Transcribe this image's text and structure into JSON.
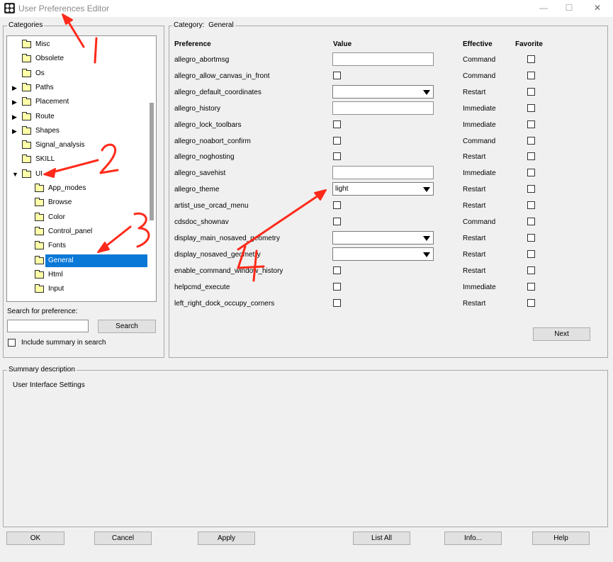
{
  "window": {
    "title": "User Preferences Editor",
    "minimize_glyph": "—",
    "maximize_glyph": "☐",
    "close_glyph": "✕"
  },
  "categories": {
    "label": "Categories",
    "items": [
      {
        "label": "Misc",
        "level": 0,
        "expander": ""
      },
      {
        "label": "Obsolete",
        "level": 0,
        "expander": ""
      },
      {
        "label": "Os",
        "level": 0,
        "expander": ""
      },
      {
        "label": "Paths",
        "level": 0,
        "expander": "▶"
      },
      {
        "label": "Placement",
        "level": 0,
        "expander": "▶"
      },
      {
        "label": "Route",
        "level": 0,
        "expander": "▶"
      },
      {
        "label": "Shapes",
        "level": 0,
        "expander": "▶"
      },
      {
        "label": "Signal_analysis",
        "level": 0,
        "expander": ""
      },
      {
        "label": "SKILL",
        "level": 0,
        "expander": ""
      },
      {
        "label": "UI",
        "level": 0,
        "expander": "▼"
      },
      {
        "label": "App_modes",
        "level": 1,
        "expander": ""
      },
      {
        "label": "Browse",
        "level": 1,
        "expander": ""
      },
      {
        "label": "Color",
        "level": 1,
        "expander": ""
      },
      {
        "label": "Control_panel",
        "level": 1,
        "expander": ""
      },
      {
        "label": "Fonts",
        "level": 1,
        "expander": ""
      },
      {
        "label": "General",
        "level": 1,
        "expander": "",
        "selected": true
      },
      {
        "label": "Html",
        "level": 1,
        "expander": ""
      },
      {
        "label": "Input",
        "level": 1,
        "expander": ""
      }
    ]
  },
  "search": {
    "label": "Search for preference:",
    "value": "",
    "button": "Search",
    "include_summary_label": "Include summary in search"
  },
  "category_panel": {
    "label": "Category:",
    "value": "General",
    "columns": {
      "preference": "Preference",
      "value": "Value",
      "effective": "Effective",
      "favorite": "Favorite"
    },
    "rows": [
      {
        "name": "allegro_abortmsg",
        "control": "text",
        "value": "",
        "effective": "Command"
      },
      {
        "name": "allegro_allow_canvas_in_front",
        "control": "check",
        "value": "",
        "effective": "Command"
      },
      {
        "name": "allegro_default_coordinates",
        "control": "combo",
        "value": "",
        "effective": "Restart"
      },
      {
        "name": "allegro_history",
        "control": "text",
        "value": "",
        "effective": "Immediate"
      },
      {
        "name": "allegro_lock_toolbars",
        "control": "check",
        "value": "",
        "effective": "Immediate"
      },
      {
        "name": "allegro_noabort_confirm",
        "control": "check",
        "value": "",
        "effective": "Command"
      },
      {
        "name": "allegro_noghosting",
        "control": "check",
        "value": "",
        "effective": "Restart"
      },
      {
        "name": "allegro_savehist",
        "control": "text",
        "value": "",
        "effective": "Immediate"
      },
      {
        "name": "allegro_theme",
        "control": "combo",
        "value": "light",
        "effective": "Restart"
      },
      {
        "name": "artist_use_orcad_menu",
        "control": "check",
        "value": "",
        "effective": "Restart"
      },
      {
        "name": "cdsdoc_shownav",
        "control": "check",
        "value": "",
        "effective": "Command"
      },
      {
        "name": "display_main_nosaved_geometry",
        "control": "combo",
        "value": "",
        "effective": "Restart"
      },
      {
        "name": "display_nosaved_geometry",
        "control": "combo",
        "value": "",
        "effective": "Restart"
      },
      {
        "name": "enable_command_window_history",
        "control": "check",
        "value": "",
        "effective": "Restart"
      },
      {
        "name": "helpcmd_execute",
        "control": "check",
        "value": "",
        "effective": "Immediate"
      },
      {
        "name": "left_right_dock_occupy_corners",
        "control": "check",
        "value": "",
        "effective": "Restart"
      }
    ],
    "next_button": "Next"
  },
  "summary": {
    "label": "Summary description",
    "text": "User Interface Settings"
  },
  "footer_buttons": [
    "OK",
    "Cancel",
    "Apply",
    "List All",
    "Info...",
    "Help"
  ],
  "annotations": {
    "color": "#ff2a1a",
    "labels": [
      "1",
      "2",
      "3",
      "4"
    ]
  }
}
